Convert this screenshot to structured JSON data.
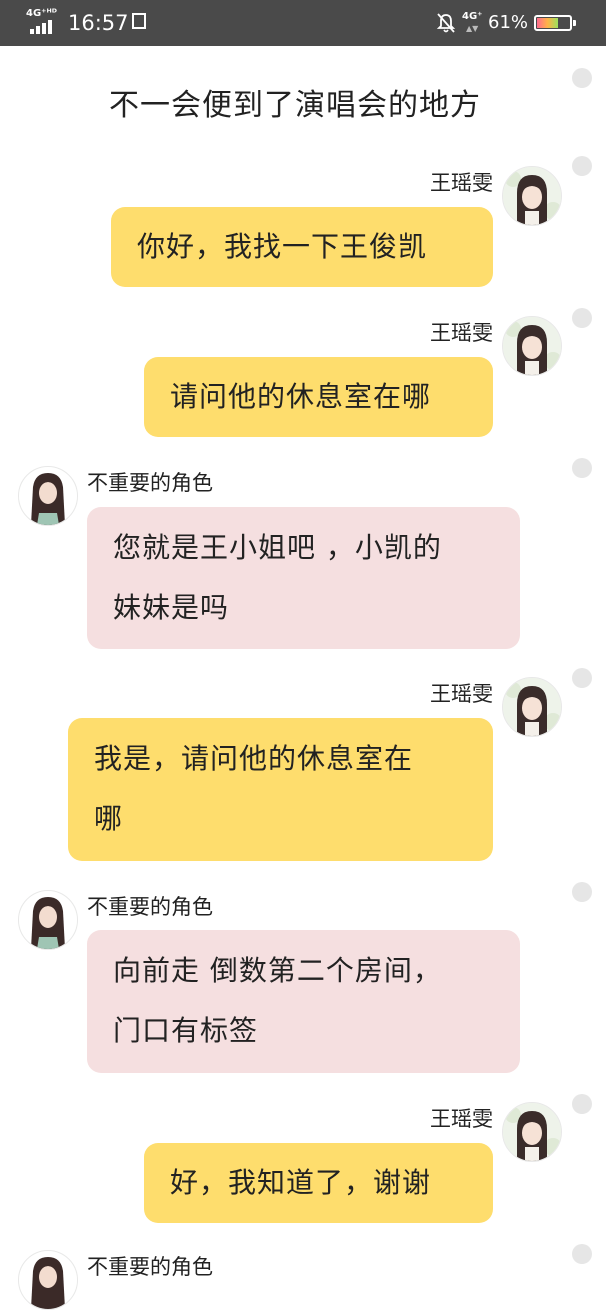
{
  "status_bar": {
    "network_left": "4G⁺ᴴᴰ",
    "time": "16:57",
    "network_right": "4G⁺",
    "battery_percent": "61%",
    "battery_level": 0.61,
    "icons": [
      "signal-icon",
      "app-notification-icon",
      "bell-muted-icon",
      "battery-icon"
    ]
  },
  "narration": "不一会便到了演唱会的地方",
  "colors": {
    "me_bubble": "#fedd6d",
    "other_bubble": "#f5dfe0",
    "status_bar": "#4a4a4a",
    "selector_dot": "#e6e6e6"
  },
  "messages": [
    {
      "sender": "王瑶雯",
      "lines": [
        "你好，我找一下王俊凯"
      ]
    },
    {
      "sender": "王瑶雯",
      "lines": [
        "请问他的休息室在哪"
      ]
    },
    {
      "sender": "不重要的角色",
      "lines": [
        "您就是王小姐吧 ，小凯的",
        "妹妹是吗"
      ]
    },
    {
      "sender": "王瑶雯",
      "lines": [
        "我是，请问他的休息室在",
        "哪"
      ]
    },
    {
      "sender": "不重要的角色",
      "lines": [
        "向前走 倒数第二个房间，",
        "门口有标签"
      ]
    },
    {
      "sender": "王瑶雯",
      "lines": [
        "好，我知道了，谢谢"
      ]
    },
    {
      "sender": "不重要的角色"
    }
  ]
}
